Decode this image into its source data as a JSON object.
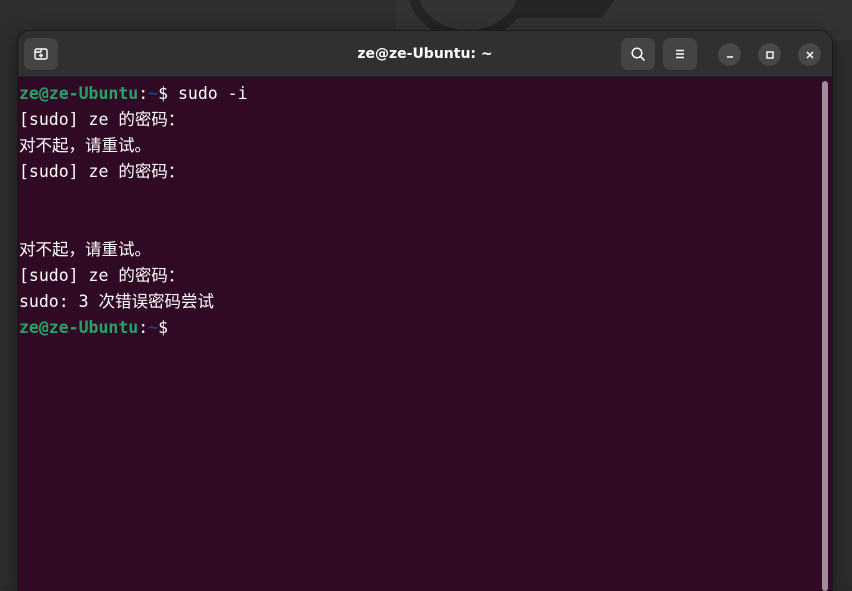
{
  "window": {
    "title": "ze@ze-Ubuntu: ~"
  },
  "headerbar": {
    "new_tab_icon": "new-tab-icon",
    "search_icon": "search-icon",
    "menu_icon": "hamburger-menu-icon",
    "minimize_icon": "minimize-icon",
    "maximize_icon": "maximize-icon",
    "close_icon": "close-icon"
  },
  "terminal": {
    "prompt_user": "ze@ze-Ubuntu",
    "prompt_sep": ":",
    "prompt_path": "~",
    "prompt_symbol": "$",
    "lines": [
      " sudo -i",
      "[sudo] ze 的密码：",
      "对不起，请重试。",
      "[sudo] ze 的密码：",
      "对不起，请重试。",
      "[sudo] ze 的密码：",
      "sudo: 3 次错误密码尝试"
    ]
  },
  "colors": {
    "terminal_bg": "#300a24",
    "prompt_user": "#26a269",
    "prompt_path": "#12488b",
    "headerbar": "#303030"
  }
}
